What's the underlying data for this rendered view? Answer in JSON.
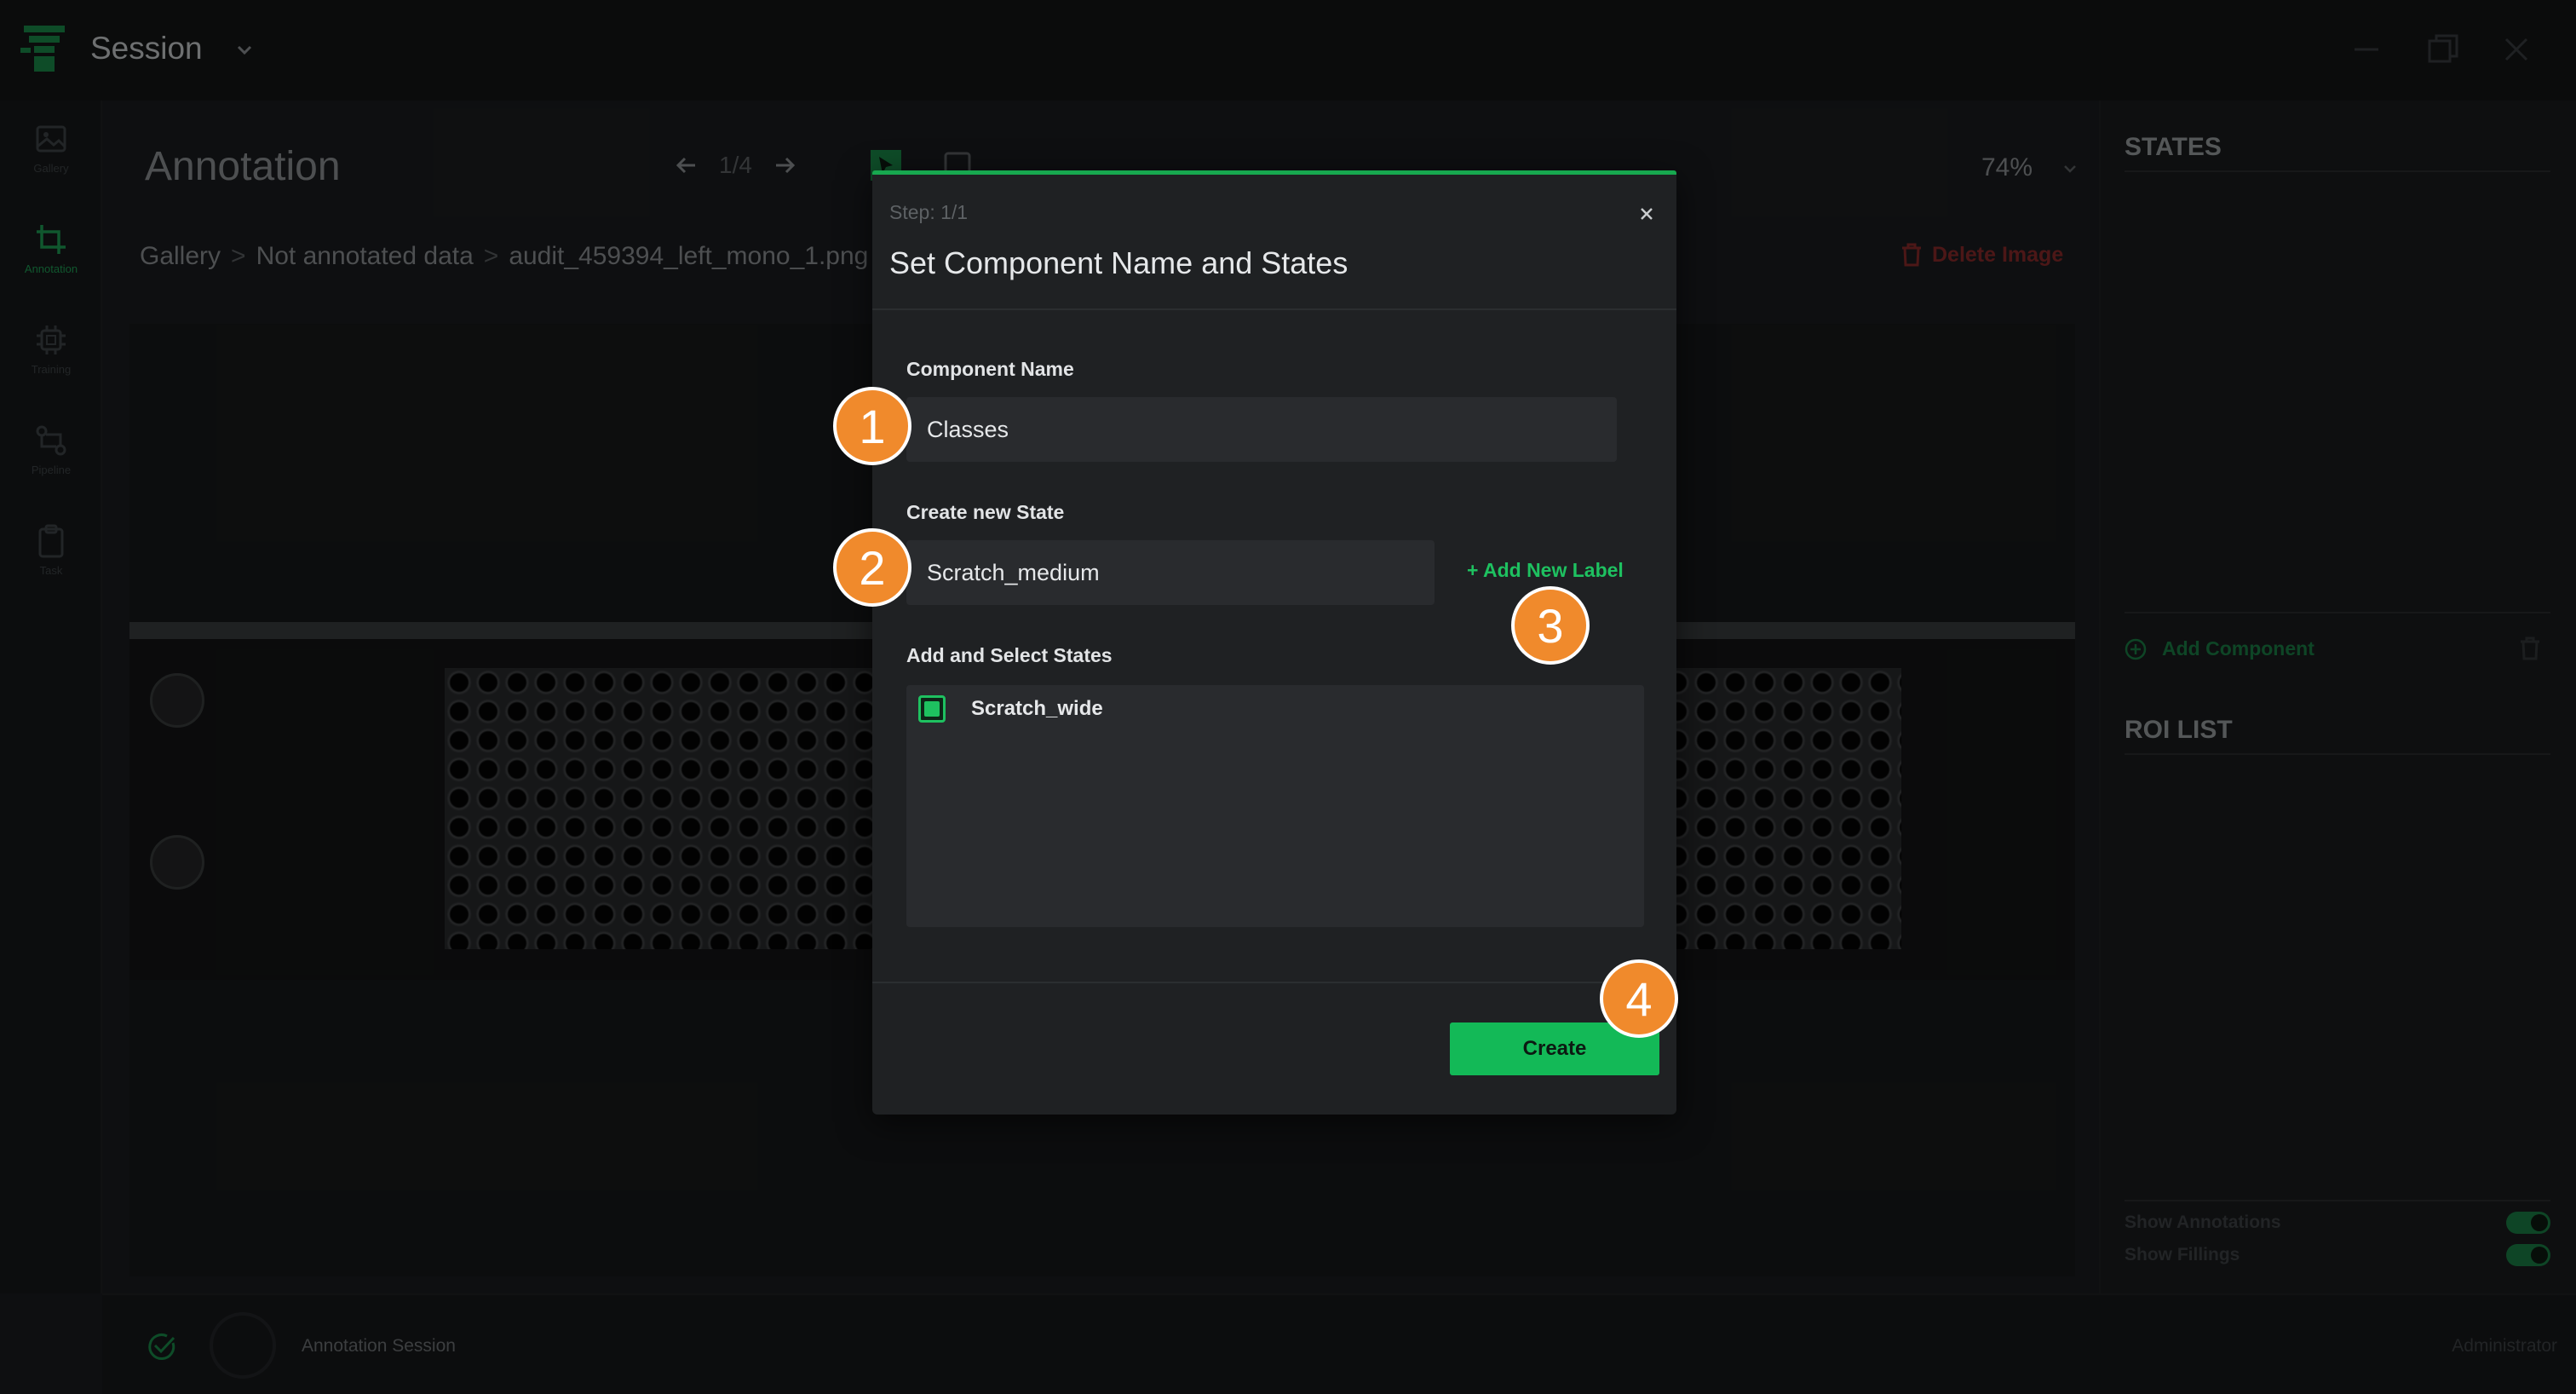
{
  "app": {
    "title": "Session"
  },
  "nav": {
    "items": [
      {
        "label": "Gallery",
        "icon": "image-icon"
      },
      {
        "label": "Annotation",
        "icon": "crop-icon"
      },
      {
        "label": "Training",
        "icon": "chip-icon"
      },
      {
        "label": "Pipeline",
        "icon": "pipeline-icon"
      },
      {
        "label": "Task",
        "icon": "clipboard-icon"
      }
    ]
  },
  "header": {
    "title": "Annotation",
    "pager": "1/4",
    "zoom": "74%"
  },
  "breadcrumb": {
    "items": [
      "Gallery",
      "Not annotated data",
      "audit_459394_left_mono_1.png"
    ],
    "separator": ">"
  },
  "actions": {
    "delete_image": "Delete Image"
  },
  "right_panel": {
    "states_title": "STATES",
    "add_component": "Add Component",
    "roi_title": "ROI LIST",
    "show_annotations": "Show Annotations",
    "show_fillings": "Show Fillings"
  },
  "status": {
    "session": "Annotation Session",
    "user": "Administrator"
  },
  "modal": {
    "step": "Step: 1/1",
    "title": "Set Component Name and States",
    "component_name_label": "Component Name",
    "component_name_value": "Classes",
    "new_state_label": "Create new State",
    "new_state_value": "Scratch_medium",
    "add_new_label": "+ Add New Label",
    "states_label": "Add and Select States",
    "states": [
      {
        "label": "Scratch_wide",
        "checked": true
      }
    ],
    "create_button": "Create"
  },
  "badges": [
    "1",
    "2",
    "3",
    "4"
  ],
  "colors": {
    "accent": "#13b957",
    "badge": "#f08a2c",
    "danger": "#8b2a2a",
    "background": "#1b1d1f"
  }
}
